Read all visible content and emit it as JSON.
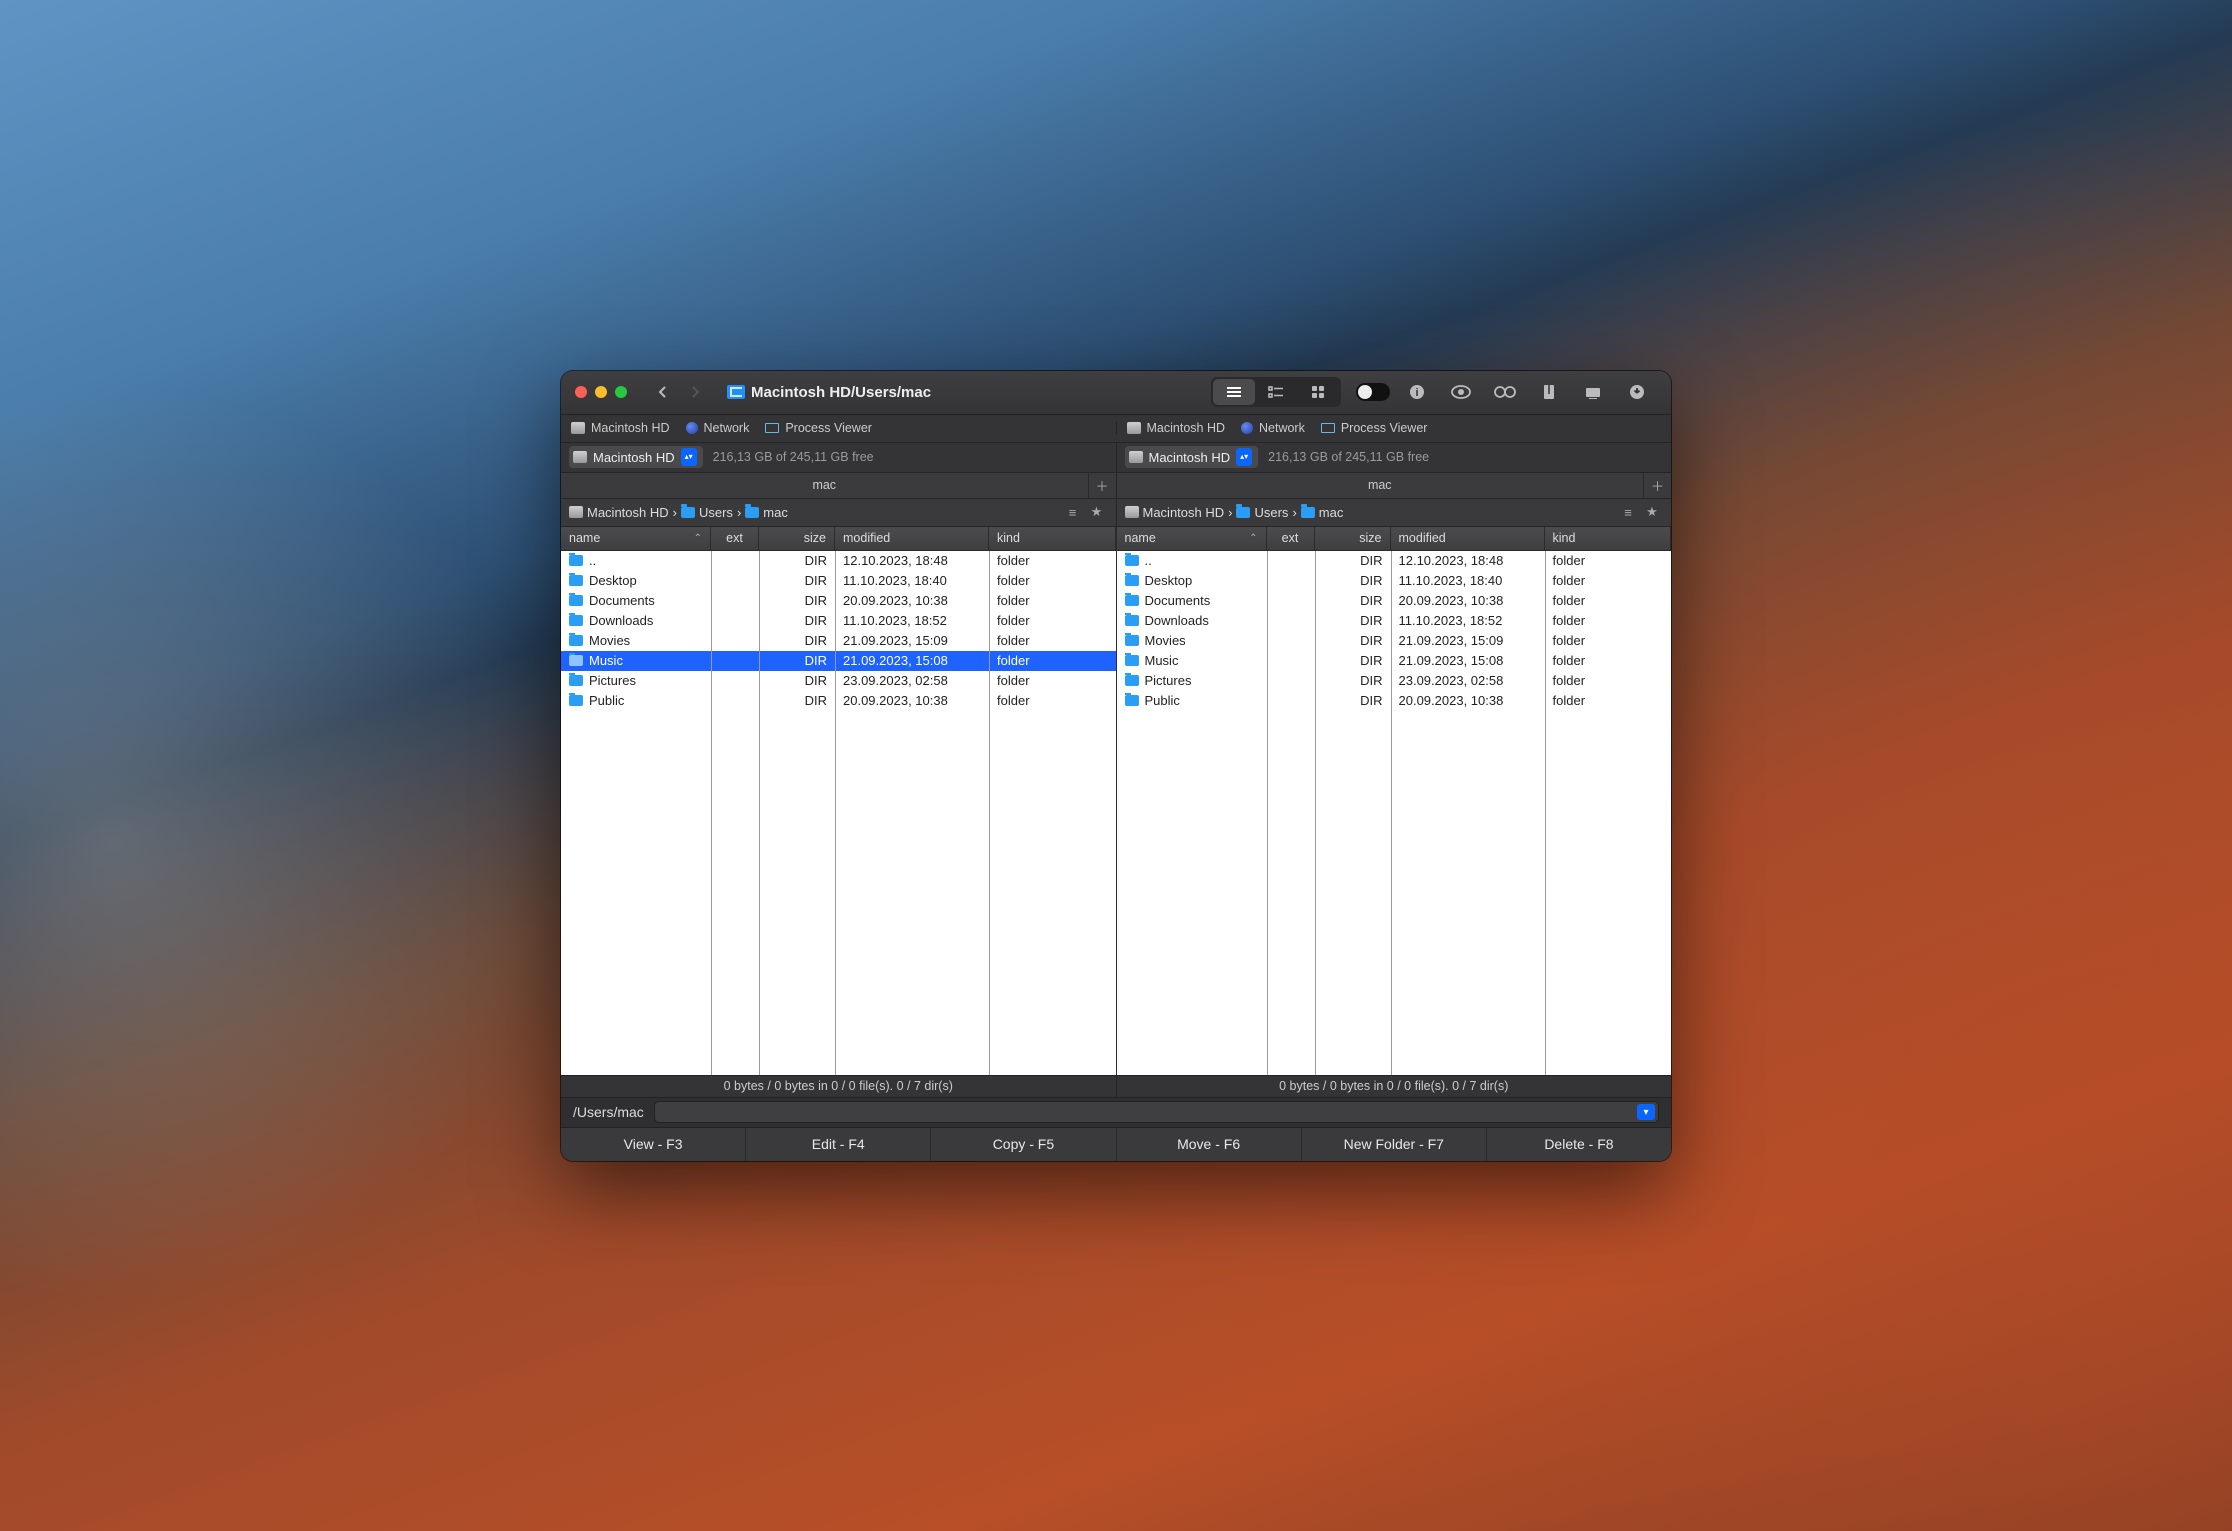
{
  "window": {
    "title": "Macintosh HD/Users/mac"
  },
  "toolbar": {
    "view_modes": [
      "list",
      "columns",
      "grid"
    ]
  },
  "locations": [
    "Macintosh HD",
    "Network",
    "Process Viewer"
  ],
  "drive": {
    "name": "Macintosh HD",
    "free_text": "216,13 GB of 245,11 GB free"
  },
  "tab_label": "mac",
  "breadcrumbs": [
    "Macintosh HD",
    "Users",
    "mac"
  ],
  "columns": {
    "name": "name",
    "ext": "ext",
    "size": "size",
    "modified": "modified",
    "kind": "kind"
  },
  "left": {
    "status": "0 bytes / 0 bytes in 0 / 0 file(s). 0 / 7 dir(s)",
    "selected_index": 5,
    "rows": [
      {
        "name": "..",
        "size": "DIR",
        "modified": "12.10.2023, 18:48",
        "kind": "folder"
      },
      {
        "name": "Desktop",
        "size": "DIR",
        "modified": "11.10.2023, 18:40",
        "kind": "folder"
      },
      {
        "name": "Documents",
        "size": "DIR",
        "modified": "20.09.2023, 10:38",
        "kind": "folder"
      },
      {
        "name": "Downloads",
        "size": "DIR",
        "modified": "11.10.2023, 18:52",
        "kind": "folder"
      },
      {
        "name": "Movies",
        "size": "DIR",
        "modified": "21.09.2023, 15:09",
        "kind": "folder"
      },
      {
        "name": "Music",
        "size": "DIR",
        "modified": "21.09.2023, 15:08",
        "kind": "folder"
      },
      {
        "name": "Pictures",
        "size": "DIR",
        "modified": "23.09.2023, 02:58",
        "kind": "folder"
      },
      {
        "name": "Public",
        "size": "DIR",
        "modified": "20.09.2023, 10:38",
        "kind": "folder"
      }
    ]
  },
  "right": {
    "status": "0 bytes / 0 bytes in 0 / 0 file(s). 0 / 7 dir(s)",
    "selected_index": -1,
    "rows": [
      {
        "name": "..",
        "size": "DIR",
        "modified": "12.10.2023, 18:48",
        "kind": "folder"
      },
      {
        "name": "Desktop",
        "size": "DIR",
        "modified": "11.10.2023, 18:40",
        "kind": "folder"
      },
      {
        "name": "Documents",
        "size": "DIR",
        "modified": "20.09.2023, 10:38",
        "kind": "folder"
      },
      {
        "name": "Downloads",
        "size": "DIR",
        "modified": "11.10.2023, 18:52",
        "kind": "folder"
      },
      {
        "name": "Movies",
        "size": "DIR",
        "modified": "21.09.2023, 15:09",
        "kind": "folder"
      },
      {
        "name": "Music",
        "size": "DIR",
        "modified": "21.09.2023, 15:08",
        "kind": "folder"
      },
      {
        "name": "Pictures",
        "size": "DIR",
        "modified": "23.09.2023, 02:58",
        "kind": "folder"
      },
      {
        "name": "Public",
        "size": "DIR",
        "modified": "20.09.2023, 10:38",
        "kind": "folder"
      }
    ]
  },
  "path_bar": {
    "label": "/Users/mac"
  },
  "fkeys": [
    "View - F3",
    "Edit - F4",
    "Copy - F5",
    "Move - F6",
    "New Folder - F7",
    "Delete - F8"
  ]
}
